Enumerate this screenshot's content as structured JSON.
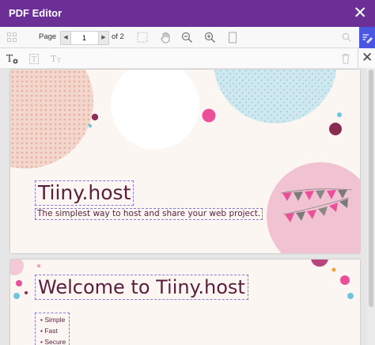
{
  "window": {
    "title": "PDF Editor",
    "close_glyph": "✕"
  },
  "toolbar": {
    "page_label": "Page",
    "page_value": "1",
    "of_label": "of 2",
    "icons": [
      "grid-icon",
      "fit-page-icon",
      "hand-pan-icon",
      "zoom-out-icon",
      "zoom-in-icon",
      "single-page-icon",
      "search-icon",
      "edit-text-icon"
    ]
  },
  "toolbar2": {
    "icons": [
      "add-text-icon",
      "text-style-icon",
      "text-size-icon",
      "trash-icon"
    ],
    "close_glyph": "✕"
  },
  "pages": [
    {
      "title": "Tiiny.host",
      "subtitle": "The simplest way to host and share your web project."
    },
    {
      "title": "Welcome to Tiiny.host",
      "features": [
        "Simple",
        "Fast",
        "Secure"
      ]
    }
  ],
  "colors": {
    "titlebar": "#6b2f96",
    "accent_button": "#4a55e0",
    "page_text": "#5a1f3d",
    "selection_border": "#8a7ad8"
  }
}
